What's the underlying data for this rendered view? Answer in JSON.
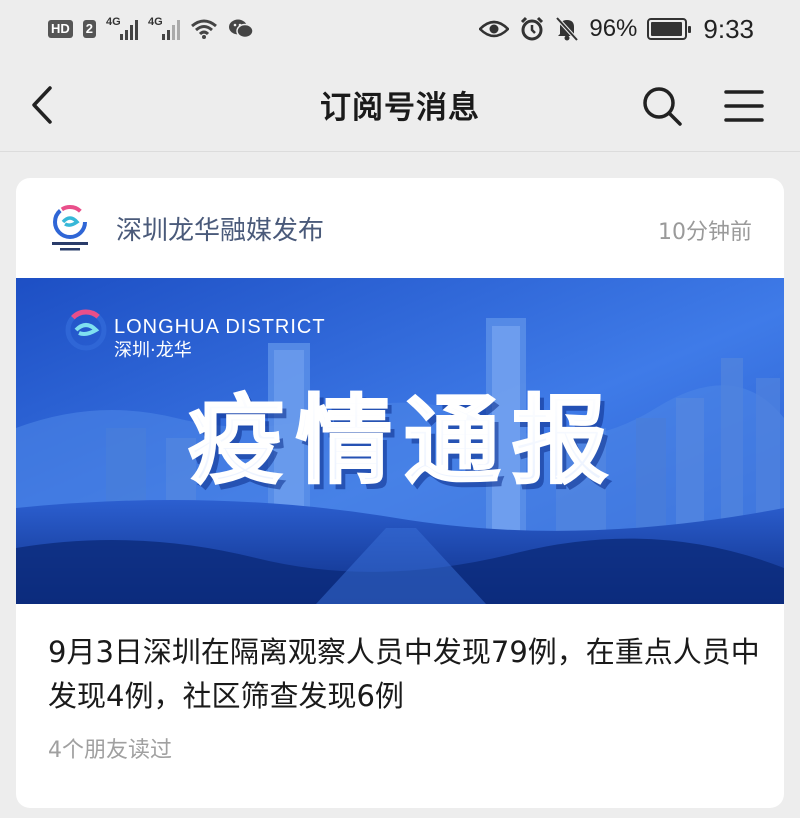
{
  "status_bar": {
    "hd_label": "HD",
    "sim2_label": "2",
    "sig1_label": "4G",
    "sig2_label": "4G",
    "icons": [
      "hd-icon",
      "signal-icon",
      "signal-icon",
      "wifi-icon",
      "wechat-icon",
      "eye-icon",
      "alarm-icon",
      "mute-icon",
      "battery-icon"
    ],
    "battery_percent": "96%",
    "battery_level": 0.96,
    "time": "9:33"
  },
  "nav": {
    "title": "订阅号消息",
    "icons": [
      "back-icon",
      "search-icon",
      "menu-icon"
    ]
  },
  "card": {
    "account_name": "深圳龙华融媒发布",
    "timestamp": "10分钟前",
    "banner": {
      "logo_text_en": "LONGHUA DISTRICT",
      "logo_text_cn": "深圳·龙华",
      "title": "疫情通报"
    },
    "headline": "9月3日深圳在隔离观察人员中发现79例，在重点人员中发现4例，社区筛查发现6例",
    "read_by": "4个朋友读过"
  },
  "colors": {
    "background": "#ededed",
    "card": "#ffffff",
    "account_name": "#4a5a7a",
    "muted": "#9a9a9a",
    "banner_blue": "#2f66d6"
  }
}
